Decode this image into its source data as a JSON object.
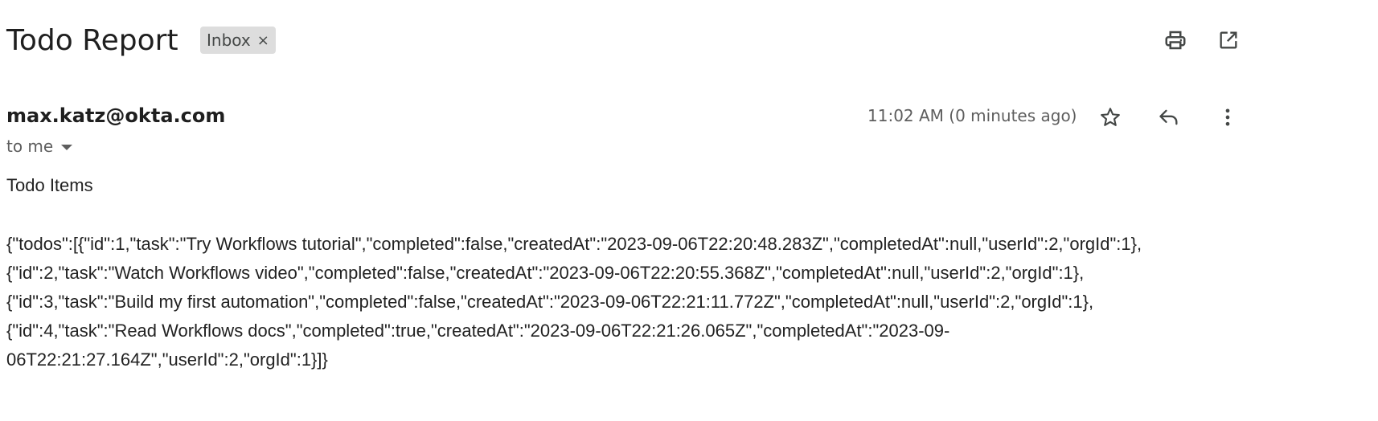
{
  "email": {
    "subject": "Todo Report",
    "label": "Inbox",
    "label_remove": "×",
    "sender": "max.katz@okta.com",
    "recipient": "to me",
    "timestamp": "11:02 AM (0 minutes ago)",
    "body_title": "Todo Items",
    "body_lines": [
      "{\"todos\":[{\"id\":1,\"task\":\"Try Workflows tutorial\",\"completed\":false,\"createdAt\":\"2023-09-06T22:20:48.283Z\",\"completedAt\":null,\"userId\":2,\"orgId\":1},",
      "{\"id\":2,\"task\":\"Watch Workflows video\",\"completed\":false,\"createdAt\":\"2023-09-06T22:20:55.368Z\",\"completedAt\":null,\"userId\":2,\"orgId\":1},",
      "{\"id\":3,\"task\":\"Build my first automation\",\"completed\":false,\"createdAt\":\"2023-09-06T22:21:11.772Z\",\"completedAt\":null,\"userId\":2,\"orgId\":1},",
      "{\"id\":4,\"task\":\"Read Workflows docs\",\"completed\":true,\"createdAt\":\"2023-09-06T22:21:26.065Z\",\"completedAt\":\"2023-09-",
      "06T22:21:27.164Z\",\"userId\":2,\"orgId\":1}]}"
    ]
  },
  "icons": {
    "print": "print-icon",
    "open_new_window": "open-in-new-icon",
    "star": "star-icon",
    "reply": "reply-icon",
    "more": "more-vert-icon",
    "recipient_caret": "caret-down-icon"
  },
  "colors": {
    "icon": "#444746",
    "chip_bg": "#dddddd",
    "secondary_text": "#5e5e5e"
  }
}
